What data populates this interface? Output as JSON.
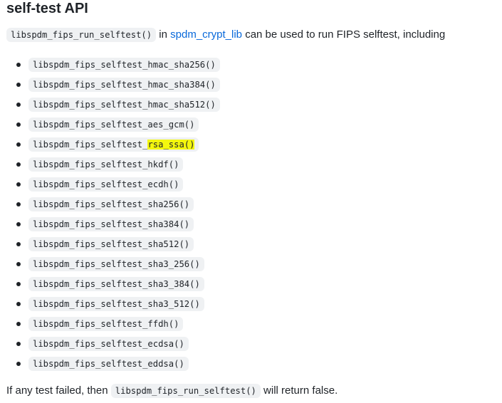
{
  "heading": "self-test API",
  "intro": {
    "code": "libspdm_fips_run_selftest()",
    "text_in": " in ",
    "link": "spdm_crypt_lib",
    "text_after": " can be used to run FIPS selftest, including"
  },
  "functions": [
    {
      "prefix": "libspdm_fips_selftest_hmac_sha256()",
      "highlight": ""
    },
    {
      "prefix": "libspdm_fips_selftest_hmac_sha384()",
      "highlight": ""
    },
    {
      "prefix": "libspdm_fips_selftest_hmac_sha512()",
      "highlight": ""
    },
    {
      "prefix": "libspdm_fips_selftest_aes_gcm()",
      "highlight": ""
    },
    {
      "prefix": "libspdm_fips_selftest_",
      "highlight": "rsa_ssa()"
    },
    {
      "prefix": "libspdm_fips_selftest_hkdf()",
      "highlight": ""
    },
    {
      "prefix": "libspdm_fips_selftest_ecdh()",
      "highlight": ""
    },
    {
      "prefix": "libspdm_fips_selftest_sha256()",
      "highlight": ""
    },
    {
      "prefix": "libspdm_fips_selftest_sha384()",
      "highlight": ""
    },
    {
      "prefix": "libspdm_fips_selftest_sha512()",
      "highlight": ""
    },
    {
      "prefix": "libspdm_fips_selftest_sha3_256()",
      "highlight": ""
    },
    {
      "prefix": "libspdm_fips_selftest_sha3_384()",
      "highlight": ""
    },
    {
      "prefix": "libspdm_fips_selftest_sha3_512()",
      "highlight": ""
    },
    {
      "prefix": "libspdm_fips_selftest_ffdh()",
      "highlight": ""
    },
    {
      "prefix": "libspdm_fips_selftest_ecdsa()",
      "highlight": ""
    },
    {
      "prefix": "libspdm_fips_selftest_eddsa()",
      "highlight": ""
    }
  ],
  "outro": {
    "text_before": "If any test failed, then ",
    "code": "libspdm_fips_run_selftest()",
    "text_after": " will return false."
  },
  "colors": {
    "text": "#1f2328",
    "link": "#0969da",
    "code_background": "#eff1f3",
    "highlight": "#f4f70e"
  }
}
